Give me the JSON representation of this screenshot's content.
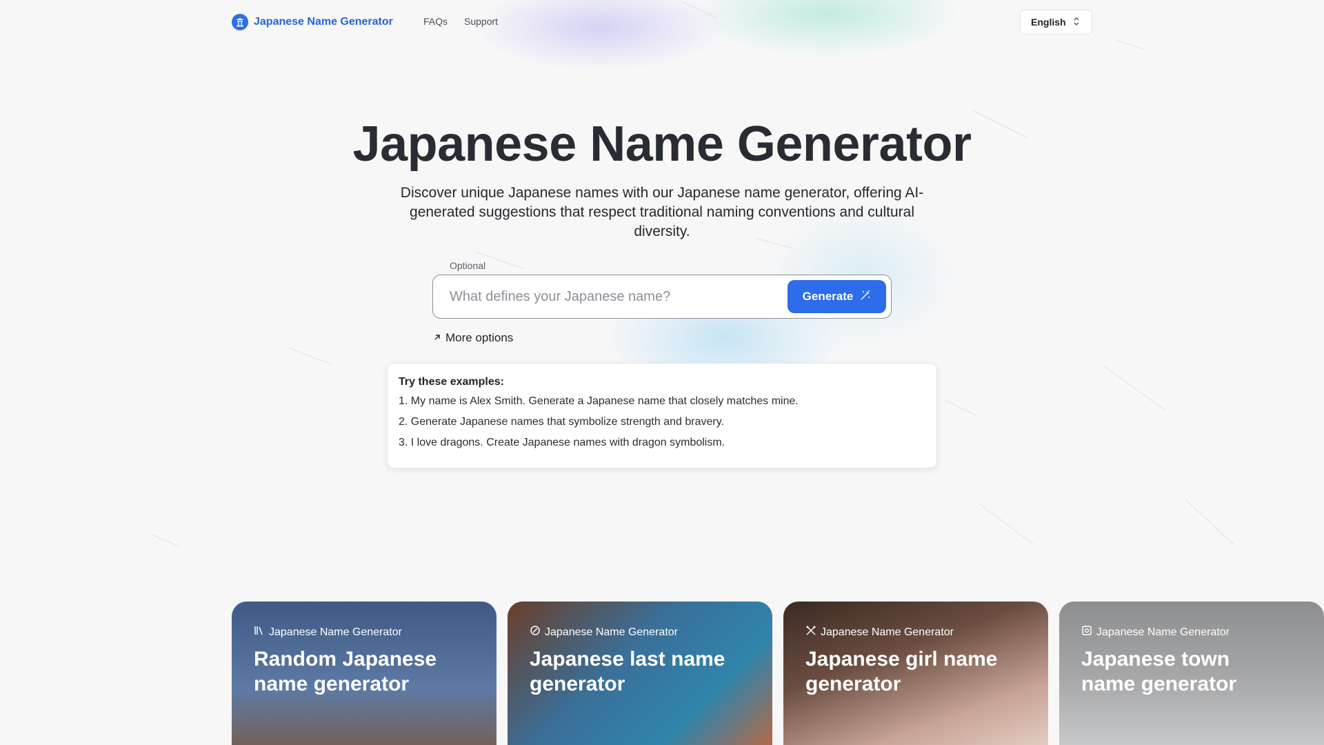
{
  "header": {
    "brand": "Japanese Name Generator",
    "links": [
      "FAQs",
      "Support"
    ],
    "language": "English"
  },
  "hero": {
    "title": "Japanese Name Generator",
    "subtitle": "Discover unique Japanese names with our Japanese name generator, offering AI-generated suggestions that respect traditional naming conventions and cultural diversity."
  },
  "search": {
    "label": "Optional",
    "placeholder": "What defines your Japanese name?",
    "button": "Generate",
    "more_options": "More options"
  },
  "examples": {
    "heading": "Try these examples:",
    "items": [
      "1. My name is Alex Smith. Generate a Japanese name that closely matches mine.",
      "2. Generate Japanese names that symbolize strength and bravery.",
      "3. I love dragons. Create Japanese names with dragon symbolism."
    ]
  },
  "cards": [
    {
      "tag": "Japanese Name Generator",
      "title": "Random Japanese name generator",
      "icon": "books-icon"
    },
    {
      "tag": "Japanese Name Generator",
      "title": "Japanese last name generator",
      "icon": "tag-badge-icon"
    },
    {
      "tag": "Japanese Name Generator",
      "title": "Japanese girl name generator",
      "icon": "crossed-tools-icon"
    },
    {
      "tag": "Japanese Name Generator",
      "title": "Japanese town name generator",
      "icon": "grid-flower-icon"
    }
  ],
  "colors": {
    "brand": "#2a62d6",
    "button": "#2d6cea",
    "title": "#2a2c33"
  }
}
